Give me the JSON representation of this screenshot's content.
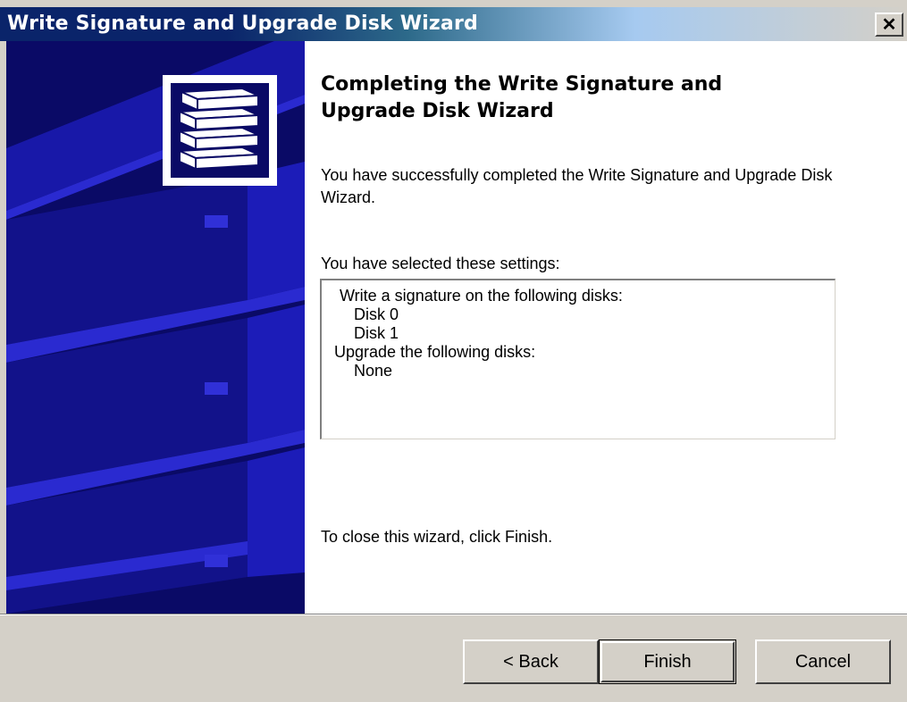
{
  "window": {
    "title": "Write Signature and Upgrade Disk Wizard",
    "close_glyph": "✕"
  },
  "content": {
    "heading": "Completing the Write Signature and Upgrade Disk Wizard",
    "description": "You have successfully completed the Write Signature and Upgrade Disk Wizard.",
    "settings_label": "You have selected these settings:",
    "settings_lines": [
      "Write a signature on the following disks:",
      "Disk 0",
      "Disk 1",
      "Upgrade the following disks:",
      "None"
    ],
    "close_hint": "To close this wizard, click Finish."
  },
  "buttons": {
    "back": "< Back",
    "finish": "Finish",
    "cancel": "Cancel"
  },
  "colors": {
    "banner": "#0a0a66",
    "title_bar": "#0a246a",
    "dialog_face": "#d4d0c8"
  },
  "icons": {
    "banner_art": "server-rack-art",
    "logo": "disk-stack-icon",
    "close": "close-icon"
  }
}
